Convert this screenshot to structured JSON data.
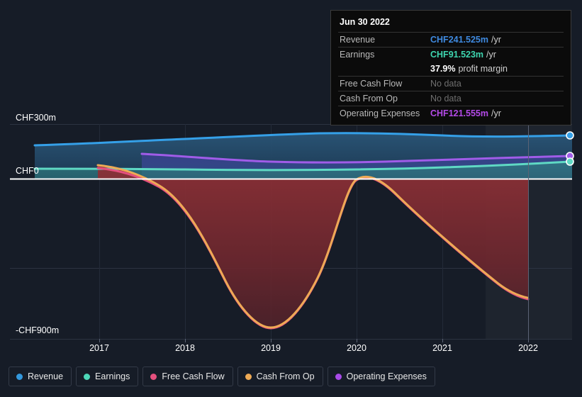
{
  "tooltip": {
    "date": "Jun 30 2022",
    "rows": [
      {
        "label": "Revenue",
        "value": "CHF241.525m",
        "suffix": "/yr"
      },
      {
        "label": "Earnings",
        "value": "CHF91.523m",
        "suffix": "/yr"
      },
      {
        "label": "",
        "value": "37.9%",
        "suffix": "profit margin"
      },
      {
        "label": "Free Cash Flow",
        "value": "No data",
        "suffix": ""
      },
      {
        "label": "Cash From Op",
        "value": "No data",
        "suffix": ""
      },
      {
        "label": "Operating Expenses",
        "value": "CHF121.555m",
        "suffix": "/yr"
      }
    ]
  },
  "chart_data": {
    "type": "area",
    "title": "",
    "xlabel": "",
    "ylabel": "",
    "currency": "CHF",
    "categories": [
      "2017",
      "2018",
      "2019",
      "2020",
      "2021",
      "2022"
    ],
    "ytick_labels": [
      "CHF300m",
      "CHF0",
      "-CHF900m"
    ],
    "ylim": [
      -900,
      300
    ],
    "yticks": [
      300,
      0,
      -300,
      -900
    ],
    "grid": true,
    "legend_position": "bottom",
    "forecast_start": "mid-2021",
    "hover_date": "Jun 30 2022",
    "colors": {
      "revenue": "#3398dd",
      "earnings": "#4dd7b8",
      "free_cash_flow": "#e5507e",
      "cash_from_op": "#eeaa55",
      "operating_expenses": "#a84ae8",
      "background": "#161c27",
      "zero_line": "#ffffff",
      "negative_area": "#7d2b32"
    },
    "legend": [
      {
        "label": "Revenue",
        "color": "#3398dd"
      },
      {
        "label": "Earnings",
        "color": "#4dd7b8"
      },
      {
        "label": "Free Cash Flow",
        "color": "#e5507e"
      },
      {
        "label": "Cash From Op",
        "color": "#eeaa55"
      },
      {
        "label": "Operating Expenses",
        "color": "#a84ae8"
      }
    ],
    "x": [
      "2016.5",
      "2017",
      "2017.5",
      "2018",
      "2018.5",
      "2019",
      "2019.5",
      "2020",
      "2020.5",
      "2021",
      "2021.5",
      "2022",
      "2022.5"
    ],
    "series": [
      {
        "name": "Revenue",
        "unit": "CHF m",
        "values": [
          188,
          195,
          205,
          222,
          233,
          240,
          248,
          252,
          250,
          243,
          238,
          240,
          241.525
        ]
      },
      {
        "name": "Earnings",
        "unit": "CHF m",
        "values": [
          56,
          55,
          55,
          53,
          52,
          50,
          50,
          51,
          54,
          58,
          66,
          80,
          91.523
        ]
      },
      {
        "name": "Free Cash Flow",
        "unit": "CHF m",
        "values": [
          null,
          null,
          60,
          -40,
          -380,
          -830,
          -840,
          -400,
          0,
          -160,
          -440,
          -670,
          null
        ]
      },
      {
        "name": "Cash From Op",
        "unit": "CHF m",
        "values": [
          null,
          null,
          75,
          -30,
          -370,
          -820,
          -830,
          -390,
          5,
          -150,
          -430,
          -660,
          null
        ]
      },
      {
        "name": "Operating Expenses",
        "unit": "CHF m",
        "values": [
          null,
          null,
          null,
          138,
          132,
          125,
          122,
          120,
          121,
          123,
          125,
          127,
          121.555
        ]
      }
    ]
  }
}
